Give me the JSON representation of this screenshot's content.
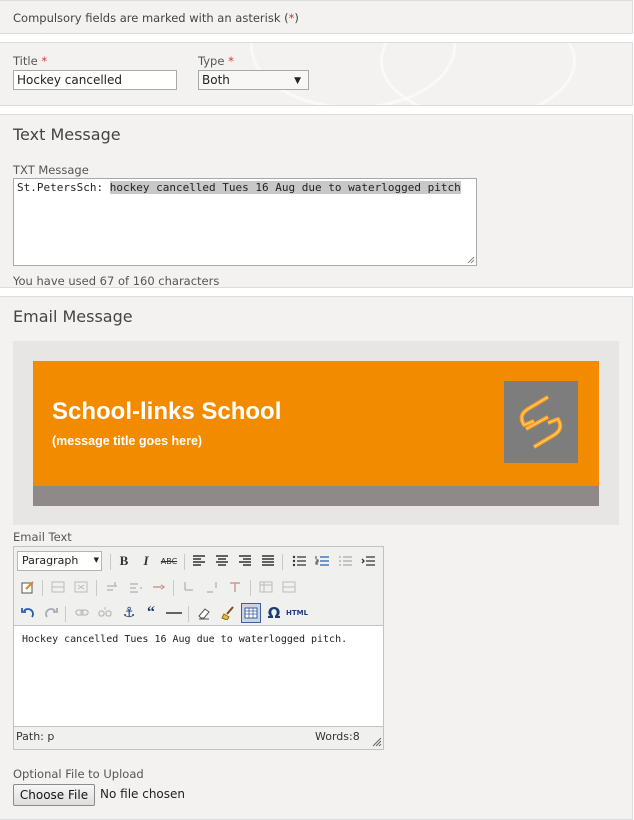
{
  "notice": {
    "text": "Compulsory fields are marked with an asterisk (",
    "asterisk": "*",
    "close": ")"
  },
  "fields": {
    "title_label": "Title",
    "title_required": "*",
    "title_value": "Hockey cancelled",
    "type_label": "Type",
    "type_required": "*",
    "type_value": "Both"
  },
  "text_message": {
    "heading": "Text Message",
    "label": "TXT Message",
    "prefix": "St.PetersSch: ",
    "body": "hockey cancelled Tues 16 Aug due to waterlogged pitch",
    "counter": "You have used 67 of 160 characters"
  },
  "email_message": {
    "heading": "Email Message",
    "banner_title": "School-links School",
    "banner_subtitle": "(message title goes here)",
    "banner_color": "#f38b00",
    "banner_footer_color": "#8f8a89",
    "logo_bg": "#7d7d7d",
    "email_text_label": "Email Text",
    "format_select": "Paragraph",
    "editor_content": "Hockey cancelled Tues 16 Aug due to waterlogged pitch.",
    "path": "Path: p",
    "words": "Words:8"
  },
  "upload": {
    "label": "Optional File to Upload",
    "button": "Choose File",
    "status": "No file chosen"
  },
  "colors": {
    "required": "#d9312a",
    "panel": "#f3f2f0"
  },
  "toolbar_icons": {
    "row1": [
      "bold-icon",
      "italic-icon",
      "strikethrough-icon",
      "align-left-icon",
      "align-center-icon",
      "align-right-icon",
      "align-justify-icon",
      "bullet-list-icon",
      "numbered-list-icon",
      "outdent-icon",
      "indent-icon"
    ],
    "row2": [
      "edit-css-icon",
      "insert-row-before-icon",
      "insert-row-after-icon",
      "insert-col-before-icon",
      "insert-col-after-icon",
      "delete-col-icon",
      "split-cells-icon",
      "merge-cells-icon",
      "delete-row-icon",
      "table-props-icon",
      "cell-props-icon"
    ],
    "row3": [
      "undo-icon",
      "redo-icon",
      "link-icon",
      "unlink-icon",
      "anchor-icon",
      "blockquote-icon",
      "horizontal-rule-icon",
      "eraser-icon",
      "cleanup-icon",
      "table-icon",
      "omega-icon",
      "html-icon"
    ]
  }
}
